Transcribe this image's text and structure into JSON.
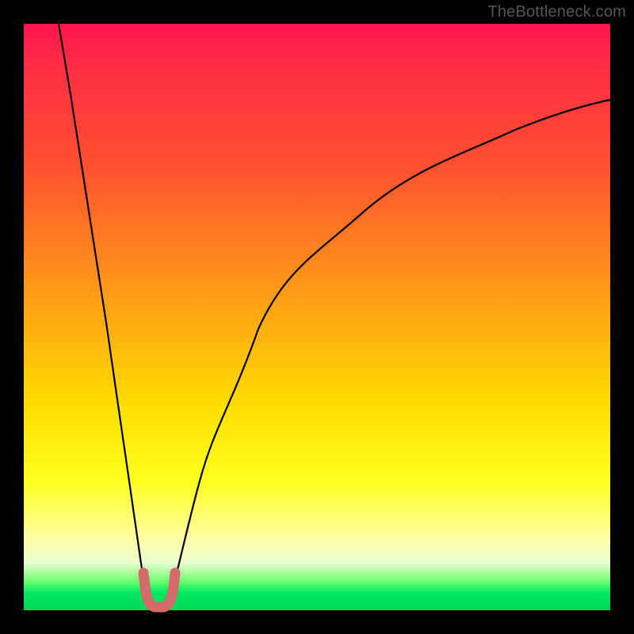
{
  "watermark": "TheBottleneck.com",
  "chart_data": {
    "type": "line",
    "title": "",
    "xlabel": "",
    "ylabel": "",
    "xlim": [
      0,
      100
    ],
    "ylim": [
      0,
      100
    ],
    "grid": false,
    "legend": false,
    "series": [
      {
        "name": "left-branch",
        "x": [
          6,
          8,
          10,
          12,
          14,
          16,
          18,
          20,
          21
        ],
        "values": [
          100,
          88,
          75,
          62,
          49,
          36,
          22,
          8,
          2
        ],
        "note": "steep descending limb from top-left toward the valley"
      },
      {
        "name": "right-branch",
        "x": [
          25,
          27,
          30,
          34,
          40,
          48,
          58,
          70,
          84,
          100
        ],
        "values": [
          2,
          10,
          22,
          35,
          48,
          59,
          68,
          76,
          82,
          87
        ],
        "note": "rising right limb, concave, toward upper-right"
      },
      {
        "name": "bottom-u-marker",
        "x": [
          21,
          21.5,
          22.5,
          23.5,
          24.5,
          25
        ],
        "values": [
          6,
          2,
          0.5,
          0.5,
          2,
          6
        ],
        "note": "small red U-shaped marker at the valley floor"
      }
    ],
    "annotations": [],
    "colors": {
      "curve": "#000000",
      "marker": "#d46a6a",
      "gradient_top": "#ff1450",
      "gradient_bottom": "#00d858"
    }
  }
}
